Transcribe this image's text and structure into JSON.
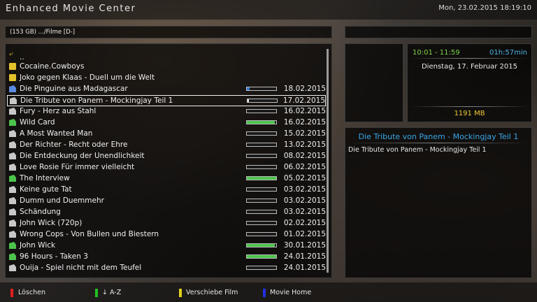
{
  "header": {
    "title": "Enhanced Movie Center",
    "datetime": "Mon, 23.02.2015  18:19:10"
  },
  "path": "(153 GB) .../Filme [D-]",
  "list": [
    {
      "type": "up",
      "name": "..",
      "date": "",
      "progress": null,
      "icon": "parent-folder-icon"
    },
    {
      "type": "folder",
      "name": "Cocaine.Cowboys",
      "date": "",
      "progress": null,
      "icon": "folder-icon"
    },
    {
      "type": "folder",
      "name": "Joko gegen Klaas - Duell um die Welt",
      "date": "",
      "progress": null,
      "icon": "folder-icon"
    },
    {
      "type": "movie",
      "color": "blue",
      "name": "Die Pinguine aus Madagascar",
      "date": "18.02.2015",
      "progress": 0.1,
      "fill": "#3a78d8",
      "icon": "movie-icon"
    },
    {
      "type": "movie",
      "color": "white",
      "name": "Die Tribute von Panem - Mockingjay Teil 1",
      "date": "17.02.2015",
      "progress": 0.03,
      "fill": "#e8e8e8",
      "icon": "movie-icon",
      "selected": true
    },
    {
      "type": "movie",
      "color": "white",
      "name": "Fury - Herz aus Stahl",
      "date": "16.02.2015",
      "progress": 0,
      "fill": "#e8e8e8",
      "icon": "movie-icon"
    },
    {
      "type": "movie",
      "color": "green",
      "name": "Wild Card",
      "date": "16.02.2015",
      "progress": 0.95,
      "fill": "#4cc44c",
      "icon": "movie-icon"
    },
    {
      "type": "movie",
      "color": "white",
      "name": "A Most Wanted Man",
      "date": "15.02.2015",
      "progress": 0,
      "fill": "#e8e8e8",
      "icon": "movie-icon"
    },
    {
      "type": "movie",
      "color": "white",
      "name": "Der Richter - Recht oder Ehre",
      "date": "13.02.2015",
      "progress": 0,
      "fill": "#e8e8e8",
      "icon": "movie-icon"
    },
    {
      "type": "movie",
      "color": "white",
      "name": "Die Entdeckung der Unendlichkeit",
      "date": "08.02.2015",
      "progress": 0,
      "fill": "#e8e8e8",
      "icon": "movie-icon"
    },
    {
      "type": "movie",
      "color": "white",
      "name": "Love Rosie Für immer vielleicht",
      "date": "06.02.2015",
      "progress": 0,
      "fill": "#e8e8e8",
      "icon": "movie-icon"
    },
    {
      "type": "movie",
      "color": "green",
      "name": "The Interview",
      "date": "05.02.2015",
      "progress": 1.0,
      "fill": "#4cc44c",
      "icon": "movie-icon"
    },
    {
      "type": "movie",
      "color": "white",
      "name": "Keine gute Tat",
      "date": "03.02.2015",
      "progress": 0,
      "fill": "#e8e8e8",
      "icon": "movie-icon"
    },
    {
      "type": "movie",
      "color": "white",
      "name": "Dumm und Duemmehr",
      "date": "03.02.2015",
      "progress": 0,
      "fill": "#e8e8e8",
      "icon": "movie-icon"
    },
    {
      "type": "movie",
      "color": "white",
      "name": "Schändung",
      "date": "03.02.2015",
      "progress": 0,
      "fill": "#e8e8e8",
      "icon": "movie-icon"
    },
    {
      "type": "movie",
      "color": "white",
      "name": "John Wick (720p)",
      "date": "02.02.2015",
      "progress": 0,
      "fill": "#e8e8e8",
      "icon": "movie-icon"
    },
    {
      "type": "movie",
      "color": "white",
      "name": "Wrong Cops - Von Bullen und Biestern",
      "date": "01.02.2015",
      "progress": 0,
      "fill": "#e8e8e8",
      "icon": "movie-icon"
    },
    {
      "type": "movie",
      "color": "green",
      "name": "John Wick",
      "date": "30.01.2015",
      "progress": 0.95,
      "fill": "#4cc44c",
      "icon": "movie-icon"
    },
    {
      "type": "movie",
      "color": "green",
      "name": "96 Hours - Taken 3",
      "date": "24.01.2015",
      "progress": 1.0,
      "fill": "#4cc44c",
      "icon": "movie-icon"
    },
    {
      "type": "movie",
      "color": "white",
      "name": "Ouija - Spiel nicht mit dem Teufel",
      "date": "24.01.2015",
      "progress": 0,
      "fill": "#e8e8e8",
      "icon": "movie-icon"
    }
  ],
  "info": {
    "time_range": "10:01 - 11:59",
    "duration": "01h:57min",
    "date": "Dienstag, 17. Februar 2015",
    "size": "1191 MB"
  },
  "description": {
    "title": "Die Tribute von Panem - Mockingjay Teil 1",
    "text": "Die Tribute von Panem - Mockingjay Teil 1"
  },
  "buttons": [
    {
      "label": "Löschen",
      "color": "#e02020"
    },
    {
      "label": "↓ A-Z",
      "color": "#20c020"
    },
    {
      "label": "Verschiebe Film",
      "color": "#e0d020"
    },
    {
      "label": "Movie Home",
      "color": "#2030e0"
    }
  ]
}
